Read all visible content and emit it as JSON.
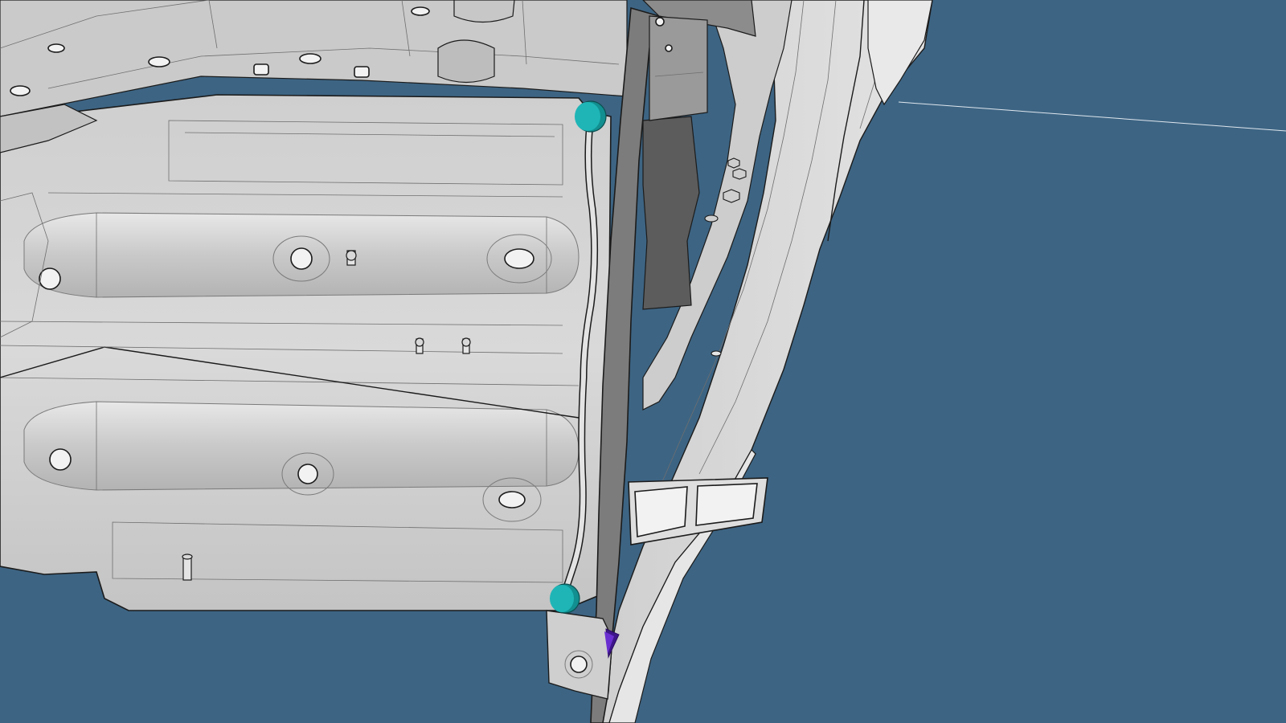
{
  "viewport": {
    "background_color": "#3d6483"
  },
  "scene": {
    "panel_color": "#d4d4d4",
    "panel_shadow_color": "#a9a9a9",
    "bracket_color": "#7c7c7c",
    "edge_color": "#1b1b1b"
  },
  "markers": [
    {
      "icon": "teal-circle-marker-icon",
      "color": "#1fb5b7"
    },
    {
      "icon": "teal-circle-marker-icon",
      "color": "#1fb5b7"
    },
    {
      "icon": "purple-triangle-marker-icon",
      "color": "#6a2fd0"
    }
  ]
}
